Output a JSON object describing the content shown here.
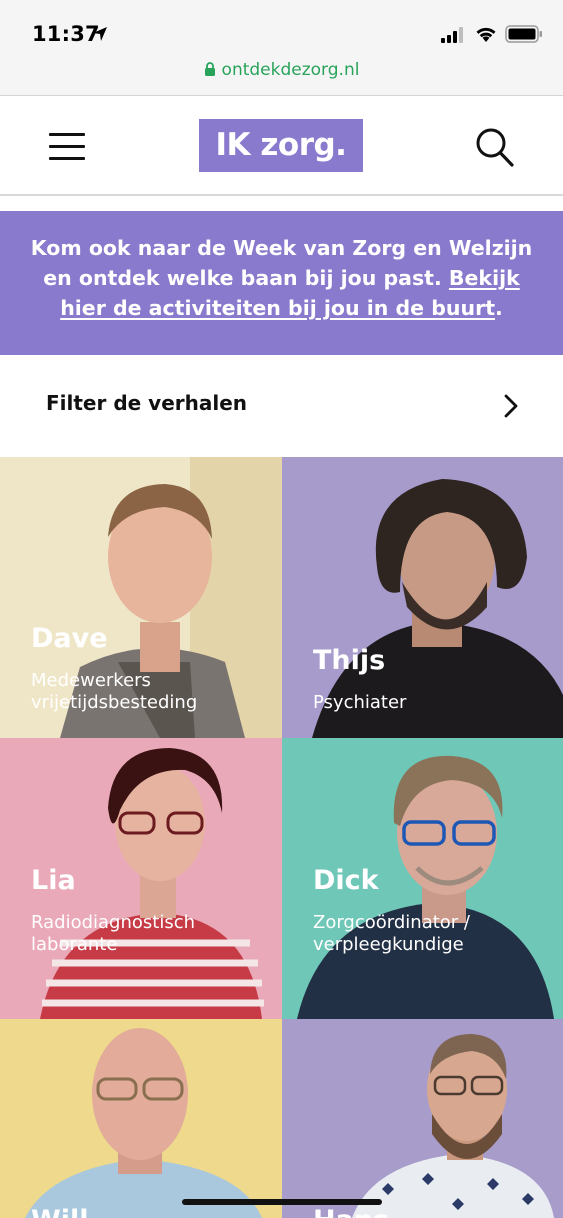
{
  "status_bar": {
    "time": "11:37",
    "icons": [
      "location-arrow-icon",
      "cellular-signal-icon",
      "wifi-icon",
      "battery-icon"
    ]
  },
  "browser": {
    "url": "ontdekdezorg.nl",
    "url_color": "#29a35a"
  },
  "header": {
    "logo_text": "IK zorg.",
    "brand_color": "#8a7acd",
    "menu_icon": "hamburger-menu-icon",
    "search_icon": "search-icon"
  },
  "banner": {
    "text": "Kom ook naar de Week van Zorg en Welzijn en ontdek welke baan bij jou past. ",
    "link_text": "Bekijk hier de activiteiten bij jou in de buurt",
    "suffix": "."
  },
  "filter": {
    "label": "Filter de verhalen",
    "icon": "chevron-right-icon"
  },
  "stories": [
    {
      "name": "Dave",
      "role": "Medewerkers vrijetijdsbesteding",
      "bg": "#efe6c8"
    },
    {
      "name": "Thijs",
      "role": "Psychiater",
      "bg": "#a79bcb"
    },
    {
      "name": "Lia",
      "role": "Radiodiagnostisch laborante",
      "bg": "#e9a9b9"
    },
    {
      "name": "Dick",
      "role": "Zorgcoördinator / verpleegkundige",
      "bg": "#6fc7b7"
    },
    {
      "name": "Will",
      "role": "",
      "bg": "#eed98c"
    },
    {
      "name": "Hans",
      "role": "",
      "bg": "#a89ccb"
    }
  ]
}
